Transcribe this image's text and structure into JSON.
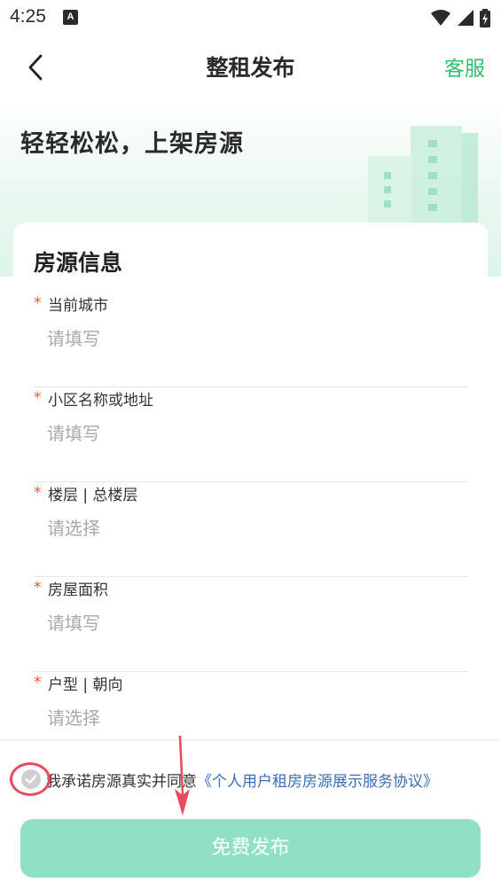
{
  "status_bar": {
    "time": "4:25",
    "notification_icon": "a-icon",
    "icons": [
      "wifi-icon",
      "signal-icon",
      "battery-icon"
    ]
  },
  "header": {
    "title": "整租发布",
    "back_icon": "chevron-left-icon",
    "service_label": "客服"
  },
  "hero": {
    "slogan": "轻轻松松，上架房源",
    "illustration": "building-icon"
  },
  "form": {
    "section_title": "房源信息",
    "required_mark": "*",
    "fields": [
      {
        "label": "当前城市",
        "placeholder": "请填写"
      },
      {
        "label": "小区名称或地址",
        "placeholder": "请填写"
      },
      {
        "label": "楼层 | 总楼层",
        "placeholder": "请选择"
      },
      {
        "label": "房屋面积",
        "placeholder": "请填写"
      },
      {
        "label": "户型 | 朝向",
        "placeholder": "请选择"
      }
    ]
  },
  "agreement": {
    "text": "我承诺房源真实并同意",
    "link": "《个人用户租房房源展示服务协议》",
    "checked": false
  },
  "publish_button": {
    "label": "免费发布",
    "color": "#8fe0c5"
  },
  "colors": {
    "accent_green": "#2fbf70",
    "required_red": "#f0552f",
    "link_blue": "#3a6fb5",
    "annotation_red": "#e84a5f"
  }
}
